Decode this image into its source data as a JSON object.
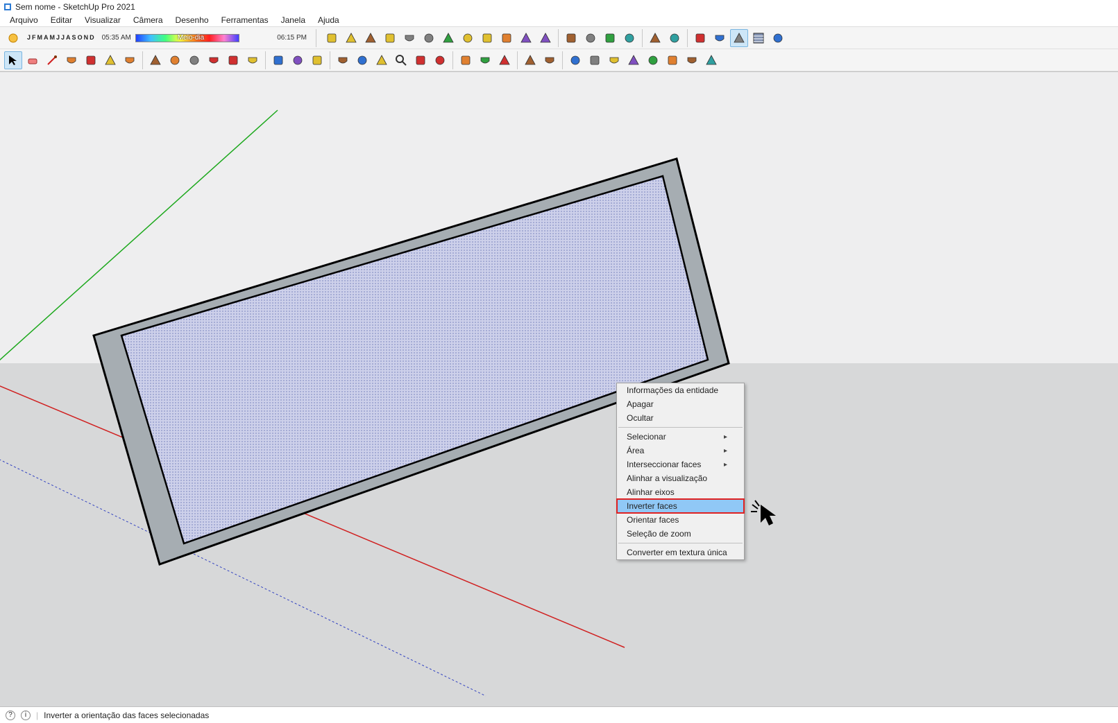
{
  "window": {
    "title": "Sem nome - SketchUp Pro 2021"
  },
  "menus": [
    "Arquivo",
    "Editar",
    "Visualizar",
    "Câmera",
    "Desenho",
    "Ferramentas",
    "Janela",
    "Ajuda"
  ],
  "months": [
    "J",
    "F",
    "M",
    "A",
    "M",
    "J",
    "J",
    "A",
    "S",
    "O",
    "N",
    "D"
  ],
  "times": {
    "left": "05:35 AM",
    "mid": "Meio-dia",
    "right": "06:15 PM"
  },
  "context_menu": {
    "items": [
      {
        "label": "Informações da entidade",
        "type": "item"
      },
      {
        "label": "Apagar",
        "type": "item"
      },
      {
        "label": "Ocultar",
        "type": "item"
      },
      {
        "type": "sep"
      },
      {
        "label": "Selecionar",
        "type": "sub"
      },
      {
        "label": "Área",
        "type": "sub"
      },
      {
        "label": "Interseccionar faces",
        "type": "sub"
      },
      {
        "label": "Alinhar a visualização",
        "type": "item"
      },
      {
        "label": "Alinhar eixos",
        "type": "item"
      },
      {
        "label": "Inverter faces",
        "type": "item",
        "highlighted": true
      },
      {
        "label": "Orientar faces",
        "type": "item"
      },
      {
        "label": "Seleção de zoom",
        "type": "item"
      },
      {
        "type": "sep"
      },
      {
        "label": "Converter em textura única",
        "type": "item"
      }
    ]
  },
  "statusbar": {
    "text": "Inverter a orientação das faces selecionadas"
  },
  "toolbar_icons_row1": [
    "model-info-icon",
    "placemark-icon",
    "preview-match-icon",
    "component-options-icon",
    "component-attributes-icon",
    "location-icon",
    "house-icon",
    "upload-icon",
    "pricing-icon",
    "3dwarehouse-icon",
    "send-icon",
    "outliner-icon",
    "sep",
    "enscape-start-icon",
    "cloud-icon",
    "clipboard-icon",
    "cost-icon",
    "sep",
    "style1-icon",
    "style2-icon",
    "sep",
    "style3-icon",
    "style4-icon",
    "style5-icon",
    "style-textured-icon",
    "style-monochrome-icon"
  ],
  "toolbar_icons_row2": [
    "select-icon",
    "eraser-icon",
    "line-icon",
    "rectangle-icon",
    "arc-icon",
    "circle-icon",
    "pushpull-icon",
    "sep",
    "paintbucket-icon",
    "followme-icon",
    "move-icon",
    "rotate-icon",
    "scale-icon",
    "offset-icon",
    "sep",
    "tape-icon",
    "text-icon",
    "dimension-icon",
    "sep",
    "softenedges-icon",
    "section-icon",
    "lookaround-icon",
    "zoom-icon",
    "zoomextents-icon",
    "position-camera-icon",
    "sep",
    "layers-icon",
    "scenes-icon",
    "shadow-icon",
    "sep",
    "scale2-icon",
    "extension-icon",
    "sep",
    "sun1-icon",
    "sun2-icon",
    "sun3-icon",
    "sun4-icon",
    "sun5-icon",
    "sun6-icon",
    "sun7-icon",
    "sun8-icon"
  ]
}
